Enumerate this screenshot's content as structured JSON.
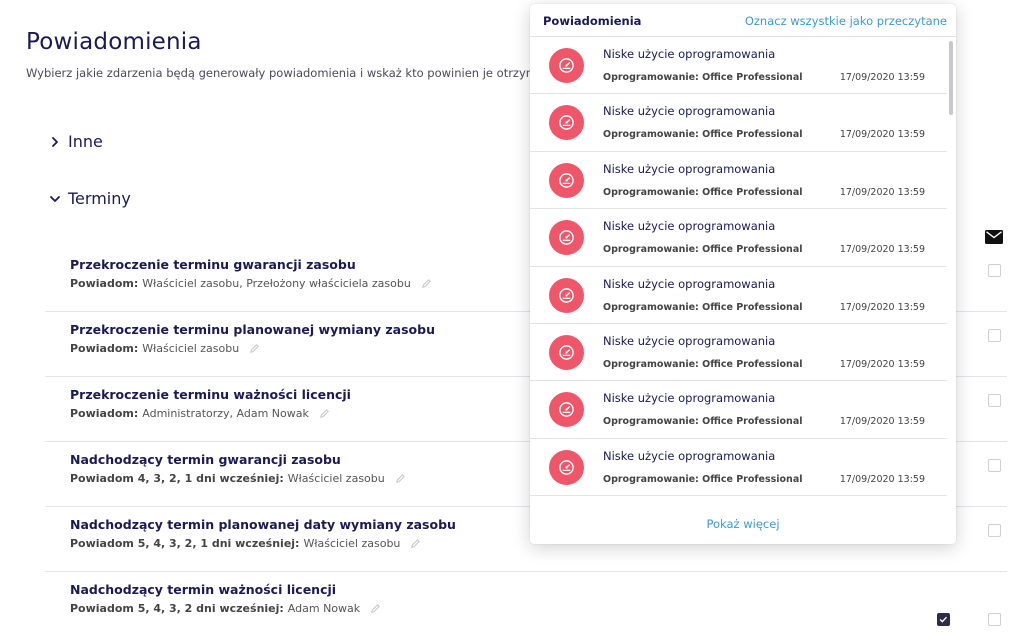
{
  "page": {
    "title": "Powiadomienia",
    "subtitle": "Wybierz jakie zdarzenia będą generowały powiadomienia i wskaż kto powinien je otrzymywać."
  },
  "sections": {
    "inne": "Inne",
    "terminy": "Terminy"
  },
  "rules": [
    {
      "title": "Przekroczenie terminu gwarancji zasobu",
      "notify_label": "Powiadom:",
      "recipients": "Właściciel zasobu, Przełożony właściciela zasobu",
      "checked": false
    },
    {
      "title": "Przekroczenie terminu planowanej wymiany zasobu",
      "notify_label": "Powiadom:",
      "recipients": "Właściciel zasobu",
      "checked": false
    },
    {
      "title": "Przekroczenie terminu ważności licencji",
      "notify_label": "Powiadom:",
      "recipients": "Administratorzy, Adam Nowak",
      "checked": false
    },
    {
      "title": "Nadchodzący termin gwarancji zasobu",
      "notify_label": "Powiadom 4, 3, 2, 1 dni wcześniej:",
      "recipients": "Właściciel zasobu",
      "checked": false
    },
    {
      "title": "Nadchodzący termin planowanej daty wymiany zasobu",
      "notify_label": "Powiadom 5, 4, 3, 2, 1 dni wcześniej:",
      "recipients": "Właściciel zasobu",
      "checked": false
    },
    {
      "title": "Nadchodzący termin ważności licencji",
      "notify_label": "Powiadom 5, 4, 3, 2 dni wcześniej:",
      "recipients": "Adam Nowak",
      "checked": true
    }
  ],
  "notifications": {
    "title": "Powiadomienia",
    "mark_all": "Oznacz wszystkie jako przeczytane",
    "show_more": "Pokaż więcej",
    "items": [
      {
        "title": "Niske użycie oprogramowania",
        "meta": "Oprogramowanie: Office Professional",
        "time": "17/09/2020 13:59"
      },
      {
        "title": "Niske użycie oprogramowania",
        "meta": "Oprogramowanie: Office Professional",
        "time": "17/09/2020 13:59"
      },
      {
        "title": "Niske użycie oprogramowania",
        "meta": "Oprogramowanie: Office Professional",
        "time": "17/09/2020 13:59"
      },
      {
        "title": "Niske użycie oprogramowania",
        "meta": "Oprogramowanie: Office Professional",
        "time": "17/09/2020 13:59"
      },
      {
        "title": "Niske użycie oprogramowania",
        "meta": "Oprogramowanie: Office Professional",
        "time": "17/09/2020 13:59"
      },
      {
        "title": "Niske użycie oprogramowania",
        "meta": "Oprogramowanie: Office Professional",
        "time": "17/09/2020 13:59"
      },
      {
        "title": "Niske użycie oprogramowania",
        "meta": "Oprogramowanie: Office Professional",
        "time": "17/09/2020 13:59"
      },
      {
        "title": "Niske użycie oprogramowania",
        "meta": "Oprogramowanie: Office Professional",
        "time": "17/09/2020 13:59"
      }
    ]
  },
  "icons": {
    "notification_icon": "gauge-icon",
    "email_column": "mail-icon",
    "edit": "pencil-icon"
  },
  "colors": {
    "primary_text": "#1b1a57",
    "link": "#3d9ad6",
    "alert_avatar": "#f0566a"
  }
}
